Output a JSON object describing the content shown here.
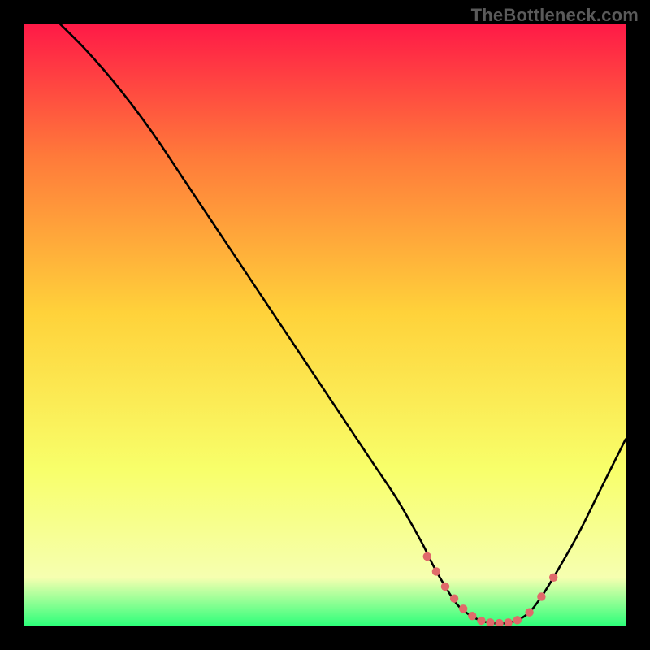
{
  "watermark": "TheBottleneck.com",
  "colors": {
    "background": "#000000",
    "gradient_top": "#ff1a47",
    "gradient_upper_mid": "#ff7a3a",
    "gradient_mid": "#ffd23a",
    "gradient_lower_mid": "#f8ff6a",
    "gradient_near_bottom": "#f6ffb0",
    "gradient_bottom": "#2eff7a",
    "curve": "#000000",
    "marker": "#e06a6a"
  },
  "chart_data": {
    "type": "line",
    "title": "",
    "xlabel": "",
    "ylabel": "",
    "xlim": [
      0,
      100
    ],
    "ylim": [
      0,
      100
    ],
    "series": [
      {
        "name": "bottleneck-curve",
        "x": [
          6,
          10,
          14,
          18,
          22,
          26,
          30,
          34,
          38,
          42,
          46,
          50,
          54,
          58,
          62,
          66,
          68,
          70,
          72,
          74,
          76,
          78,
          80,
          82,
          84,
          86,
          88,
          92,
          96,
          100
        ],
        "y": [
          100,
          96,
          91.5,
          86.5,
          81,
          75,
          69,
          63,
          57,
          51,
          45,
          39,
          33,
          27,
          21,
          14,
          10,
          6.5,
          3.5,
          1.8,
          0.8,
          0.4,
          0.4,
          0.9,
          2.2,
          4.8,
          8,
          15,
          23,
          31
        ]
      }
    ],
    "markers": {
      "name": "highlight-dots",
      "x": [
        67,
        68.5,
        70,
        71.5,
        73,
        74.5,
        76,
        77.5,
        79,
        80.5,
        82,
        84,
        86,
        88
      ],
      "y": [
        11.5,
        9,
        6.5,
        4.5,
        2.8,
        1.6,
        0.8,
        0.5,
        0.4,
        0.5,
        0.9,
        2.2,
        4.8,
        8
      ]
    }
  }
}
